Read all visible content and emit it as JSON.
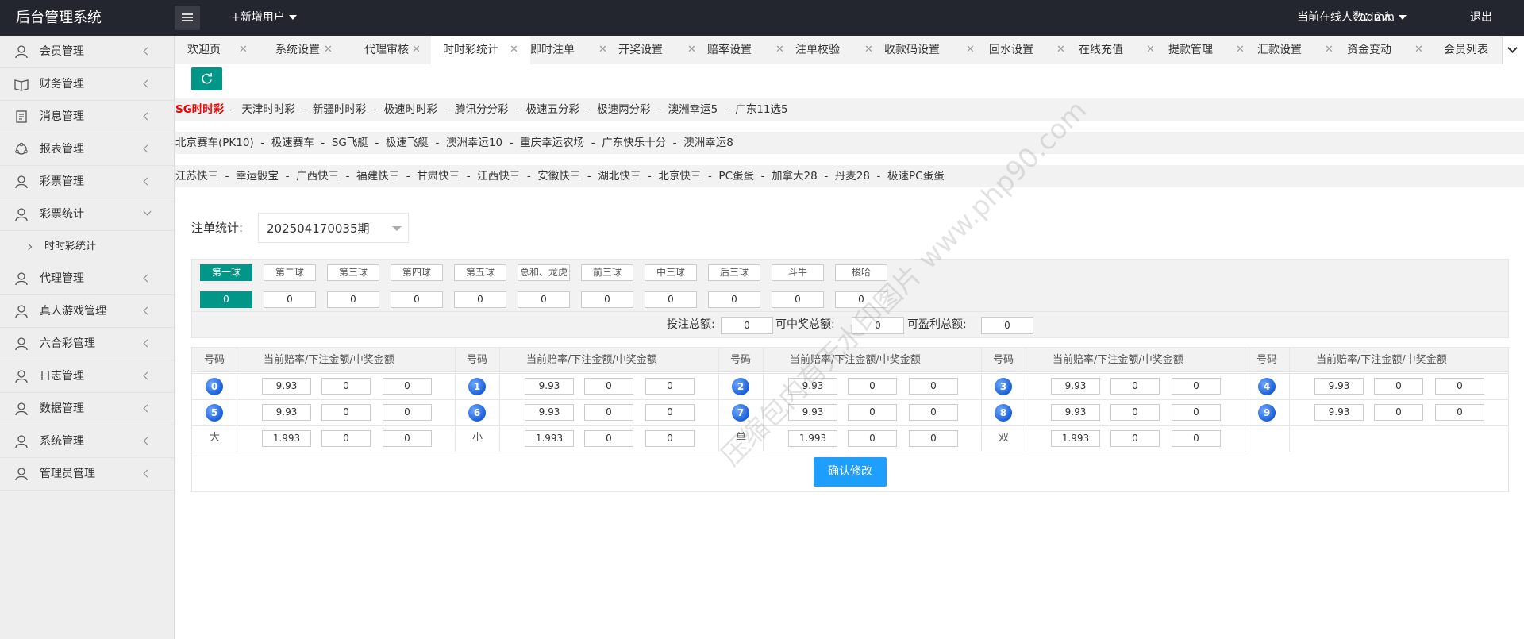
{
  "header": {
    "title": "后台管理系统",
    "add_user": "+新增用户",
    "online": "当前在线人数：2人",
    "admin": "admin",
    "logout": "退出"
  },
  "sidebar": {
    "items": [
      {
        "label": "会员管理",
        "icon": "user-icon"
      },
      {
        "label": "财务管理",
        "icon": "book-icon"
      },
      {
        "label": "消息管理",
        "icon": "doc-icon"
      },
      {
        "label": "报表管理",
        "icon": "chart-icon"
      },
      {
        "label": "彩票管理",
        "icon": "user-icon"
      },
      {
        "label": "彩票统计",
        "icon": "user-icon"
      },
      {
        "label": "代理管理",
        "icon": "user-icon"
      },
      {
        "label": "真人游戏管理",
        "icon": "user-icon"
      },
      {
        "label": "六合彩管理",
        "icon": "user-icon"
      },
      {
        "label": "日志管理",
        "icon": "user-icon"
      },
      {
        "label": "数据管理",
        "icon": "user-icon"
      },
      {
        "label": "系统管理",
        "icon": "user-icon"
      },
      {
        "label": "管理员管理",
        "icon": "user-icon"
      }
    ],
    "sub_item": "时时彩统计"
  },
  "tabs": [
    "欢迎页",
    "系统设置",
    "代理审核",
    "时时彩统计",
    "即时注单",
    "开奖设置",
    "赔率设置",
    "注单校验",
    "收款码设置",
    "回水设置",
    "在线充值",
    "提款管理",
    "汇款设置",
    "资金变动",
    "会员列表"
  ],
  "lottery_rows": [
    [
      "SG时时彩",
      "天津时时彩",
      "新疆时时彩",
      "极速时时彩",
      "腾讯分分彩",
      "极速五分彩",
      "极速两分彩",
      "澳洲幸运5",
      "广东11选5"
    ],
    [
      "北京赛车(PK10)",
      "极速赛车",
      "SG飞艇",
      "极速飞艇",
      "澳洲幸运10",
      "重庆幸运农场",
      "广东快乐十分",
      "澳洲幸运8"
    ],
    [
      "江苏快三",
      "幸运骰宝",
      "广西快三",
      "福建快三",
      "甘肃快三",
      "江西快三",
      "安徽快三",
      "湖北快三",
      "北京快三",
      "PC蛋蛋",
      "加拿大28",
      "丹麦28",
      "极速PC蛋蛋"
    ]
  ],
  "stat": {
    "label": "注单统计:",
    "period": "202504170035期"
  },
  "ball_tabs": [
    "第一球",
    "第二球",
    "第三球",
    "第四球",
    "第五球",
    "总和、龙虎",
    "前三球",
    "中三球",
    "后三球",
    "斗牛",
    "梭哈"
  ],
  "ball_values": [
    "0",
    "0",
    "0",
    "0",
    "0",
    "0",
    "0",
    "0",
    "0",
    "0",
    "0"
  ],
  "totals": {
    "bet_label": "投注总额:",
    "bet_value": "0",
    "win_label": "可中奖总额:",
    "win_value": "0",
    "profit_label": "可盈利总额:",
    "profit_value": "0"
  },
  "grid": {
    "col_num": "号码",
    "col_data": "当前赔率/下注金额/中奖金额",
    "rows": [
      [
        {
          "n": "0",
          "o": "9.93",
          "b": "0",
          "w": "0"
        },
        {
          "n": "1",
          "o": "9.93",
          "b": "0",
          "w": "0"
        },
        {
          "n": "2",
          "o": "9.93",
          "b": "0",
          "w": "0"
        },
        {
          "n": "3",
          "o": "9.93",
          "b": "0",
          "w": "0"
        },
        {
          "n": "4",
          "o": "9.93",
          "b": "0",
          "w": "0"
        }
      ],
      [
        {
          "n": "5",
          "o": "9.93",
          "b": "0",
          "w": "0"
        },
        {
          "n": "6",
          "o": "9.93",
          "b": "0",
          "w": "0"
        },
        {
          "n": "7",
          "o": "9.93",
          "b": "0",
          "w": "0"
        },
        {
          "n": "8",
          "o": "9.93",
          "b": "0",
          "w": "0"
        },
        {
          "n": "9",
          "o": "9.93",
          "b": "0",
          "w": "0"
        }
      ],
      [
        {
          "n": "大",
          "o": "1.993",
          "b": "0",
          "w": "0"
        },
        {
          "n": "小",
          "o": "1.993",
          "b": "0",
          "w": "0"
        },
        {
          "n": "单",
          "o": "1.993",
          "b": "0",
          "w": "0"
        },
        {
          "n": "双",
          "o": "1.993",
          "b": "0",
          "w": "0"
        }
      ]
    ],
    "confirm": "确认修改"
  },
  "watermark": "压缩包内有无水印图片 www.php90.com",
  "colors": {
    "accent": "#009688",
    "blue": "#1e9fff",
    "highlight": "#e00000",
    "topbar": "#23262e"
  }
}
